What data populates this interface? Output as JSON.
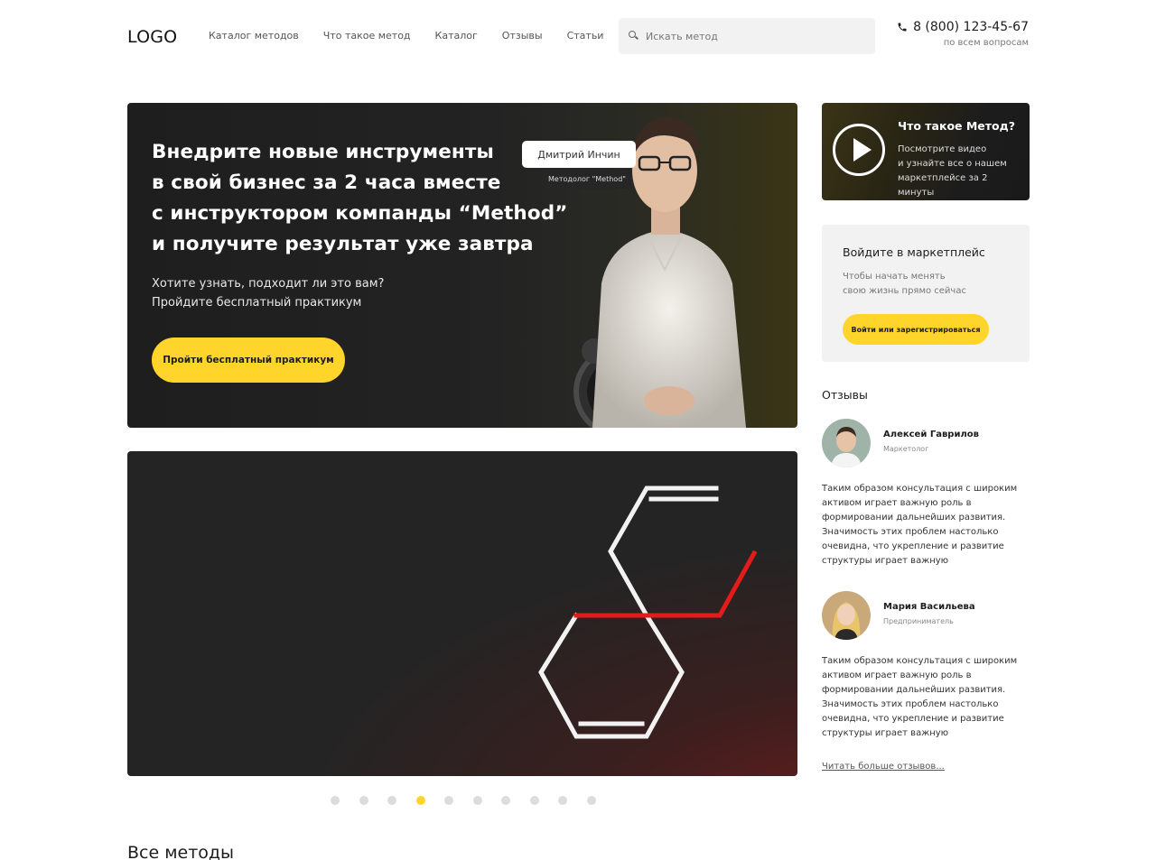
{
  "header": {
    "logo": "LOGO",
    "nav": [
      "Каталог методов",
      "Что такое метод",
      "Каталог",
      "Отзывы",
      "Статьи"
    ],
    "search_placeholder": "Искать метод",
    "phone": "8 (800) 123-45-67",
    "phone_sub": "по всем вопросам"
  },
  "hero": {
    "title_lines": [
      "Внедрите новые инструменты",
      "в свой бизнес за 2 часа вместе",
      "с инструктором компанды “Method”",
      "и получите результат уже завтра"
    ],
    "lead_lines": [
      "Хотите узнать, подходит ли это вам?",
      "Пройдите бесплатный практикум"
    ],
    "cta": "Пройти бесплатный практикум",
    "person_name": "Дмитрий Инчин",
    "person_role": "Методолог \"Method\""
  },
  "slider": {
    "dot_count": 10,
    "active_index": 3
  },
  "sections": {
    "all_methods": "Все методы"
  },
  "video_card": {
    "title": "Что такое Метод?",
    "text_lines": [
      "Посмотрите видео",
      "и узнайте все о нашем",
      "маркетплейсе за 2 минуты"
    ]
  },
  "login_card": {
    "title": "Войдите в маркетплейс",
    "text_lines": [
      "Чтобы начать менять",
      "свою жизнь прямо сейчас"
    ],
    "button": "Войти или зарегистрироваться"
  },
  "reviews": {
    "title": "Отзывы",
    "items": [
      {
        "name": "Алексей Гаврилов",
        "role": "Маркетолог",
        "text": "Таким образом консультация с широким активом играет важную роль в формировании дальнейших развития. Значимость этих проблем настолько очевидна, что укрепление и развитие структуры играет важную"
      },
      {
        "name": "Мария Васильева",
        "role": "Предприниматель",
        "text": "Таким образом консультация с широким активом играет важную роль в формировании дальнейших развития. Значимость этих проблем настолько очевидна, что укрепление и развитие структуры играет важную"
      }
    ],
    "more": "Читать больше отзывов..."
  },
  "colors": {
    "accent": "#ffd52b",
    "dark": "#232323",
    "red": "#e41b1b"
  }
}
